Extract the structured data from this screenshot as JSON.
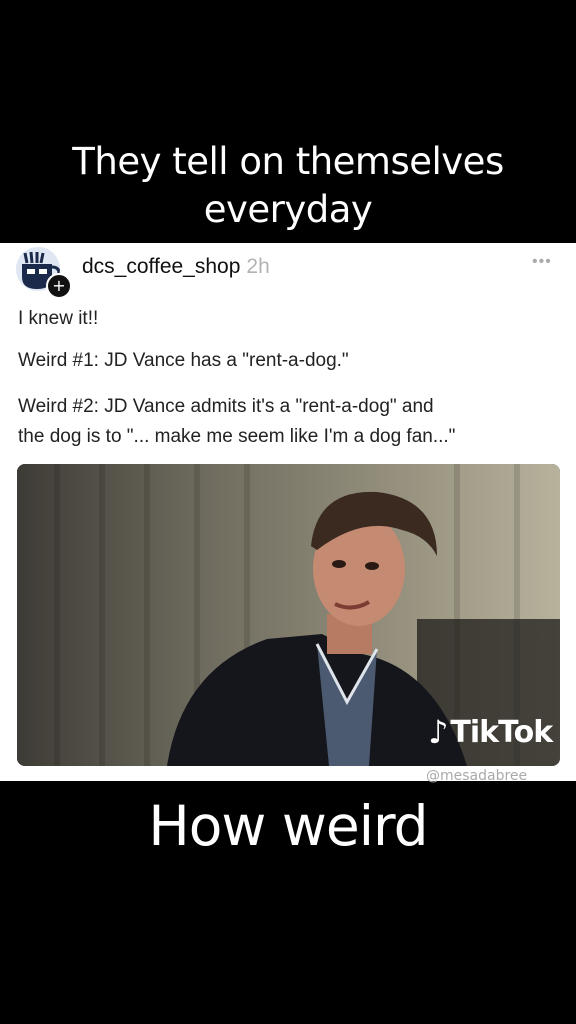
{
  "captions": {
    "top_line1": "They tell on themselves",
    "top_line2": "everyday",
    "bottom": "How weird"
  },
  "post": {
    "username": "dcs_coffee_shop",
    "time": "2h",
    "more_icon": "more-options-icon",
    "lines": [
      "I knew it!!",
      "Weird #1: JD Vance has a \"rent-a-dog.\"",
      "Weird #2: JD Vance admits it's a \"rent-a-dog\" and",
      "the dog is to \"... make me seem like I'm a dog fan...\""
    ]
  },
  "watermark": {
    "brand": "TikTok",
    "handle": "@mesadabree"
  }
}
